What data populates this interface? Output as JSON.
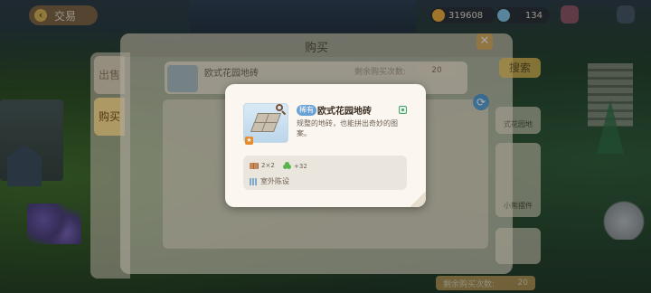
{
  "hud": {
    "back_label": "交易",
    "coin_value": "319608",
    "gem_value": "134"
  },
  "window": {
    "title": "购买",
    "close_label": "✕",
    "side_tabs": [
      "出售",
      "购买"
    ],
    "search_label": "搜索",
    "row_item_name": "欧式花园地砖",
    "row_stock_label": "剩余购买次数:",
    "row_qty": "20",
    "right_cards": [
      "式花园地",
      "小熊摆件"
    ],
    "remaining_label": "剩余购买次数:",
    "remaining_value": "20"
  },
  "popup": {
    "rarity": "稀有",
    "item_name": "欧式花园地砖",
    "description": "规整的地砖，也能拼出奇妙的图案。",
    "stat_size": "2×2",
    "stat_score": "+32",
    "category": "室外陈设",
    "icons": [
      "magnify-icon",
      "info-icon",
      "tiles-icon",
      "clover-icon",
      "category-icon"
    ]
  },
  "colors": {
    "rarity_badge": "#6aa2d6",
    "popup_bg": "#fbf7f0",
    "window_bg": "#f1ead9",
    "accent_button": "#e8c056"
  }
}
